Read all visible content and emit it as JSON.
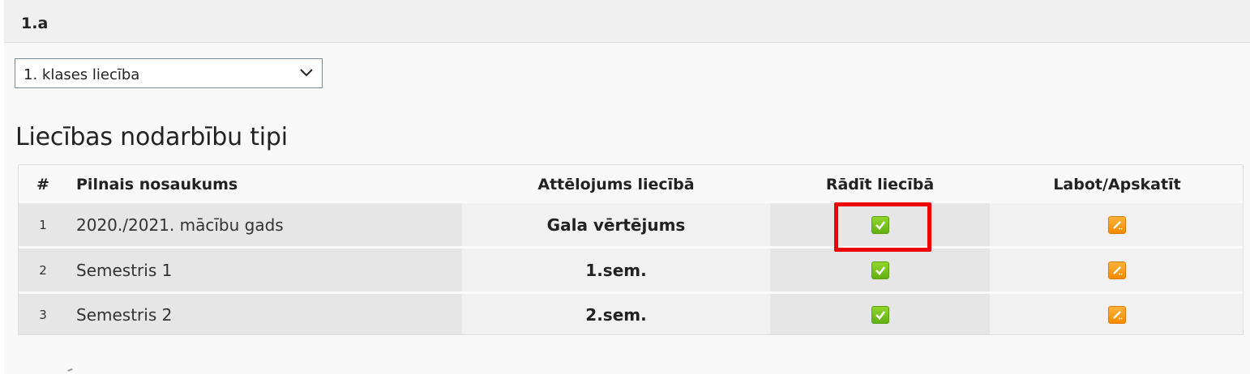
{
  "header": {
    "class_name": "1.a"
  },
  "certificate_select": {
    "value": "1. klases liecība"
  },
  "section": {
    "title": "Liecības nodarbību tipi"
  },
  "table": {
    "columns": [
      "#",
      "Pilnais nosaukums",
      "Attēlojums liecībā",
      "Rādīt liecībā",
      "Labot/Apskatīt"
    ],
    "rows": [
      {
        "num": "1",
        "name": "2020./2021. mācību gads",
        "display": "Gala vērtējums",
        "show": true
      },
      {
        "num": "2",
        "name": "Semestris 1",
        "display": "1.sem.",
        "show": true
      },
      {
        "num": "3",
        "name": "Semestris 2",
        "display": "2.sem.",
        "show": true
      }
    ]
  },
  "colors": {
    "check_green": "#6bbf16",
    "edit_orange": "#f59a1a",
    "highlight_red": "#ee0000"
  },
  "icons": {
    "show": "checkbox-checked-icon",
    "edit": "edit-pencil-icon",
    "dropdown": "chevron-down-icon"
  }
}
